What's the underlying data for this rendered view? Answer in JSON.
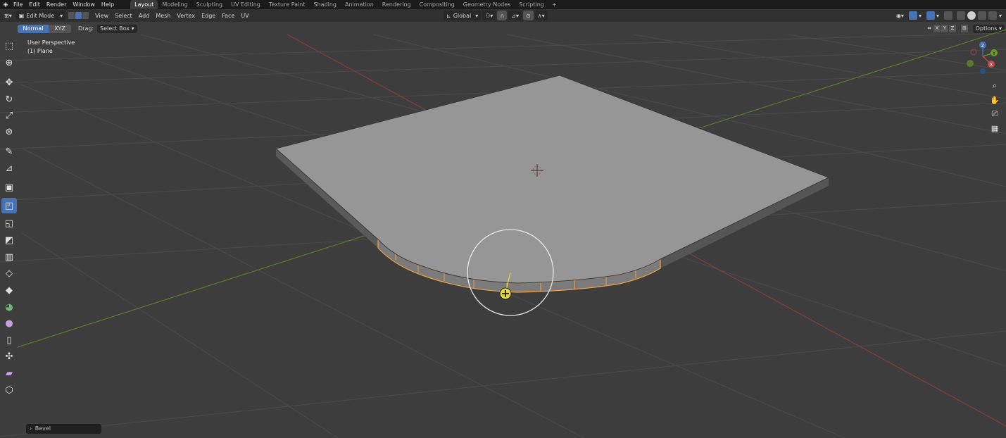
{
  "top_menu": {
    "items": [
      "File",
      "Edit",
      "Render",
      "Window",
      "Help"
    ],
    "workspaces": [
      "Layout",
      "Modeling",
      "Sculpting",
      "UV Editing",
      "Texture Paint",
      "Shading",
      "Animation",
      "Rendering",
      "Compositing",
      "Geometry Nodes",
      "Scripting"
    ],
    "active_workspace": "Layout",
    "add_workspace": "+"
  },
  "header": {
    "mode": "Edit Mode",
    "menus": [
      "View",
      "Select",
      "Add",
      "Mesh",
      "Vertex",
      "Edge",
      "Face",
      "UV"
    ],
    "transform_orientation": "Global"
  },
  "tool_header": {
    "orientation_normal": "Normal",
    "orientation_xyz": "XYZ",
    "drag_label": "Drag:",
    "drag_value": "Select Box",
    "axes": [
      "X",
      "Y",
      "Z"
    ],
    "options": "Options"
  },
  "viewport": {
    "view_name": "User Perspective",
    "object_info": "(1) Plane",
    "operator_panel": "Bevel",
    "gizmo_labels": [
      "Z",
      "Y",
      "X"
    ]
  },
  "toolbar": {
    "tools": [
      "select-box",
      "cursor",
      "move",
      "rotate",
      "scale",
      "transform",
      "annotate",
      "measure",
      "add-cube",
      "extrude",
      "inset",
      "bevel",
      "loop-cut",
      "knife",
      "poly-build",
      "spin",
      "smooth",
      "edge-slide",
      "shrink-fatten",
      "shear",
      "rip-region"
    ],
    "active_tool": "bevel"
  },
  "colors": {
    "accent": "#4772b3",
    "background": "#3d3d3d",
    "selection": "#f0a040",
    "x_axis": "#c24b4b",
    "y_axis": "#6c9a2c"
  }
}
